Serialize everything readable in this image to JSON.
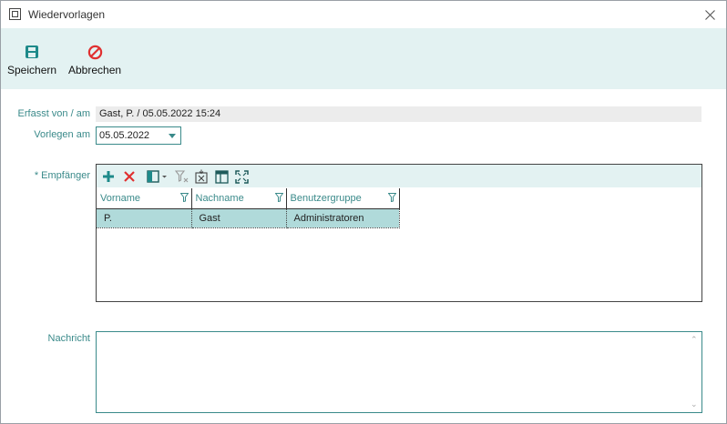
{
  "window": {
    "title": "Wiedervorlagen"
  },
  "toolbar": {
    "save_label": "Speichern",
    "cancel_label": "Abbrechen"
  },
  "form": {
    "created_label": "Erfasst von / am",
    "created_value": "Gast, P. / 05.05.2022 15:24",
    "due_label": "Vorlegen am",
    "due_value": "05.05.2022",
    "recipients_label": "* Empfänger",
    "message_label": "Nachricht",
    "message_value": ""
  },
  "grid": {
    "columns": [
      "Vorname",
      "Nachname",
      "Benutzergruppe"
    ],
    "rows": [
      {
        "vorname": "P.",
        "nachname": "Gast",
        "gruppe": "Administratoren"
      }
    ]
  },
  "colors": {
    "accent": "#3a8a8a",
    "ribbon_bg": "#e3f2f2",
    "selected_row": "#b0dada",
    "save_icon": "#1e8a8a",
    "cancel_icon": "#e03030"
  }
}
